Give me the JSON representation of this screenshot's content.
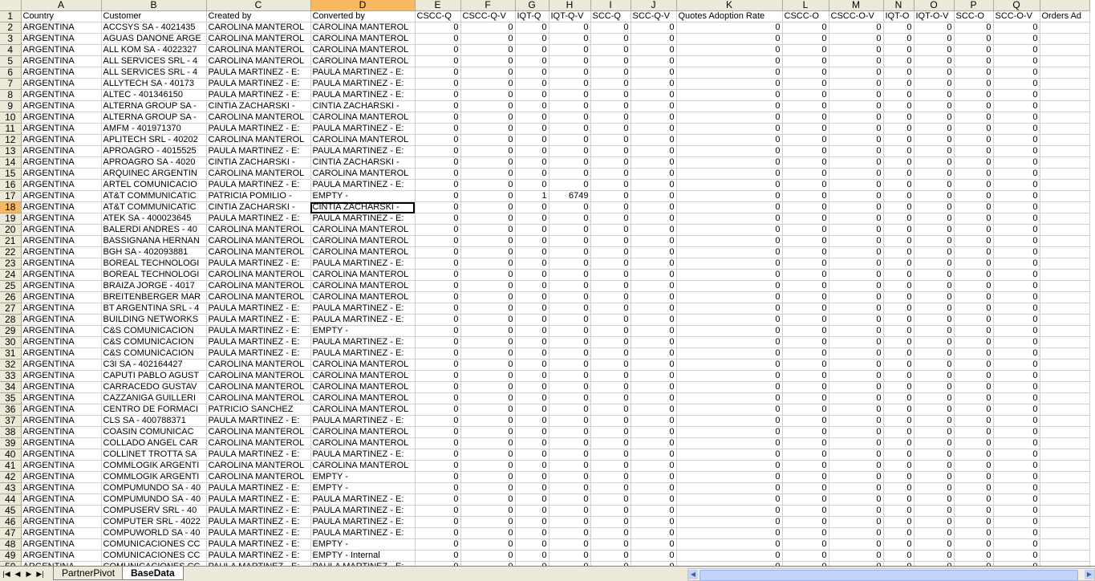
{
  "sheet": {
    "column_letters": [
      "A",
      "B",
      "C",
      "D",
      "E",
      "F",
      "G",
      "H",
      "I",
      "J",
      "K",
      "L",
      "M",
      "N",
      "O",
      "P",
      "Q",
      ""
    ],
    "selected_column": "D",
    "selected_row": 18,
    "headers": [
      "Country",
      "Customer",
      "Created by",
      "Converted by",
      "CSCC-Q",
      "CSCC-Q-V",
      "IQT-Q",
      "IQT-Q-V",
      "SCC-Q",
      "SCC-Q-V",
      "Quotes Adoption Rate",
      "CSCC-O",
      "CSCC-O-V",
      "IQT-O",
      "IQT-O-V",
      "SCC-O",
      "SCC-O-V",
      "Orders Ad"
    ],
    "rows": [
      [
        "ARGENTINA",
        "ACCSYS SA - 4021435",
        "CAROLINA  MANTEROL",
        "CAROLINA  MANTEROL"
      ],
      [
        "ARGENTINA",
        "AGUAS DANONE ARGE",
        "CAROLINA  MANTEROL",
        "CAROLINA  MANTEROL"
      ],
      [
        "ARGENTINA",
        "ALL KOM SA - 4022327",
        "CAROLINA  MANTEROL",
        "CAROLINA  MANTEROL"
      ],
      [
        "ARGENTINA",
        "ALL SERVICES SRL - 4",
        "CAROLINA  MANTEROL",
        "CAROLINA  MANTEROL"
      ],
      [
        "ARGENTINA",
        "ALL SERVICES SRL - 4",
        "PAULA  MARTINEZ - E:",
        "PAULA  MARTINEZ - E:"
      ],
      [
        "ARGENTINA",
        "ALLYTECH SA - 40173",
        "PAULA  MARTINEZ - E:",
        "PAULA  MARTINEZ - E:"
      ],
      [
        "ARGENTINA",
        "ALTEC - 401346150",
        "PAULA  MARTINEZ - E:",
        "PAULA  MARTINEZ - E:"
      ],
      [
        "ARGENTINA",
        "ALTERNA GROUP SA -",
        "CINTIA  ZACHARSKI -",
        "CINTIA  ZACHARSKI -"
      ],
      [
        "ARGENTINA",
        "ALTERNA GROUP SA -",
        "CAROLINA  MANTEROL",
        "CAROLINA  MANTEROL"
      ],
      [
        "ARGENTINA",
        "AMFM - 401971370",
        "PAULA  MARTINEZ - E:",
        "PAULA  MARTINEZ - E:"
      ],
      [
        "ARGENTINA",
        "APLITECH SRL - 40202",
        "CAROLINA  MANTEROL",
        "CAROLINA  MANTEROL"
      ],
      [
        "ARGENTINA",
        "APROAGRO - 4015525",
        "PAULA  MARTINEZ - E:",
        "PAULA  MARTINEZ - E:"
      ],
      [
        "ARGENTINA",
        "APROAGRO SA - 4020",
        "CINTIA  ZACHARSKI -",
        "CINTIA  ZACHARSKI -"
      ],
      [
        "ARGENTINA",
        "ARQUINEC ARGENTIN",
        "CAROLINA  MANTEROL",
        "CAROLINA  MANTEROL"
      ],
      [
        "ARGENTINA",
        "ARTEL COMUNICACIO",
        "PAULA  MARTINEZ - E:",
        "PAULA  MARTINEZ - E:"
      ],
      [
        "ARGENTINA",
        "AT&T COMMUNICATIC",
        "PATRICIA  POMILIO -",
        "EMPTY -"
      ],
      [
        "ARGENTINA",
        "AT&T COMMUNICATIC",
        "CINTIA  ZACHARSKI -",
        "CINTIA  ZACHARSKI -"
      ],
      [
        "ARGENTINA",
        "ATEK SA - 400023645",
        "PAULA  MARTINEZ - E:",
        "PAULA  MARTINEZ - E:"
      ],
      [
        "ARGENTINA",
        "BALERDI ANDRES - 40",
        "CAROLINA  MANTEROL",
        "CAROLINA  MANTEROL"
      ],
      [
        "ARGENTINA",
        "BASSIGNANA HERNAN",
        "CAROLINA  MANTEROL",
        "CAROLINA  MANTEROL"
      ],
      [
        "ARGENTINA",
        "BGH SA - 402093881",
        "CAROLINA  MANTEROL",
        "CAROLINA  MANTEROL"
      ],
      [
        "ARGENTINA",
        "BOREAL TECHNOLOGI",
        "PAULA  MARTINEZ - E:",
        "PAULA  MARTINEZ - E:"
      ],
      [
        "ARGENTINA",
        "BOREAL TECHNOLOGI",
        "CAROLINA  MANTEROL",
        "CAROLINA  MANTEROL"
      ],
      [
        "ARGENTINA",
        "BRAIZA JORGE - 4017",
        "CAROLINA  MANTEROL",
        "CAROLINA  MANTEROL"
      ],
      [
        "ARGENTINA",
        "BREITENBERGER MAR",
        "CAROLINA  MANTEROL",
        "CAROLINA  MANTEROL"
      ],
      [
        "ARGENTINA",
        "BT ARGENTINA SRL - 4",
        "PAULA  MARTINEZ - E:",
        "PAULA  MARTINEZ - E:"
      ],
      [
        "ARGENTINA",
        "BUILDING NETWORKS",
        "PAULA  MARTINEZ - E:",
        "PAULA  MARTINEZ - E:"
      ],
      [
        "ARGENTINA",
        "C&S COMUNICACION",
        "PAULA  MARTINEZ - E:",
        "EMPTY -"
      ],
      [
        "ARGENTINA",
        "C&S COMUNICACION",
        "PAULA  MARTINEZ - E:",
        "PAULA  MARTINEZ - E:"
      ],
      [
        "ARGENTINA",
        "C&S COMUNICACION",
        "PAULA  MARTINEZ - E:",
        "PAULA  MARTINEZ - E:"
      ],
      [
        "ARGENTINA",
        "C3I SA - 402164427",
        "CAROLINA  MANTEROL",
        "CAROLINA  MANTEROL"
      ],
      [
        "ARGENTINA",
        "CAPUTI PABLO AGUST",
        "CAROLINA  MANTEROL",
        "CAROLINA  MANTEROL"
      ],
      [
        "ARGENTINA",
        "CARRACEDO GUSTAV",
        "CAROLINA  MANTEROL",
        "CAROLINA  MANTEROL"
      ],
      [
        "ARGENTINA",
        "CAZZANIGA GUILLERI",
        "CAROLINA  MANTEROL",
        "CAROLINA  MANTEROL"
      ],
      [
        "ARGENTINA",
        "CENTRO DE FORMACI",
        "PATRICIO  SANCHEZ",
        "CAROLINA  MANTEROL"
      ],
      [
        "ARGENTINA",
        "CLS SA - 400788371",
        "PAULA  MARTINEZ - E:",
        "PAULA  MARTINEZ - E:"
      ],
      [
        "ARGENTINA",
        "COASIN COMUNICAC",
        "CAROLINA  MANTEROL",
        "CAROLINA  MANTEROL"
      ],
      [
        "ARGENTINA",
        "COLLADO ANGEL CAR",
        "CAROLINA  MANTEROL",
        "CAROLINA  MANTEROL"
      ],
      [
        "ARGENTINA",
        "COLLINET TROTTA SA",
        "PAULA  MARTINEZ - E:",
        "PAULA  MARTINEZ - E:"
      ],
      [
        "ARGENTINA",
        "COMMLOGIK ARGENTI",
        "CAROLINA  MANTEROL",
        "CAROLINA  MANTEROL"
      ],
      [
        "ARGENTINA",
        "COMMLOGIK ARGENTI",
        "CAROLINA  MANTEROL",
        "EMPTY -"
      ],
      [
        "ARGENTINA",
        "COMPUMUNDO SA - 40",
        "PAULA  MARTINEZ - E:",
        "EMPTY -"
      ],
      [
        "ARGENTINA",
        "COMPUMUNDO SA - 40",
        "PAULA  MARTINEZ - E:",
        "PAULA  MARTINEZ - E:"
      ],
      [
        "ARGENTINA",
        "COMPUSERV SRL - 40",
        "PAULA  MARTINEZ - E:",
        "PAULA  MARTINEZ - E:"
      ],
      [
        "ARGENTINA",
        "COMPUTER SRL - 4022",
        "PAULA  MARTINEZ - E:",
        "PAULA  MARTINEZ - E:"
      ],
      [
        "ARGENTINA",
        "COMPUWORLD SA - 40",
        "PAULA  MARTINEZ - E:",
        "PAULA  MARTINEZ - E:"
      ],
      [
        "ARGENTINA",
        "COMUNICACIONES CC",
        "PAULA  MARTINEZ - E:",
        "EMPTY -"
      ],
      [
        "ARGENTINA",
        "COMUNICACIONES CC",
        "PAULA  MARTINEZ - E:",
        "EMPTY - Internal"
      ],
      [
        "ARGENTINA",
        "COMUNICACIONES CC",
        "PAULA  MARTINEZ - E:",
        "PAULA  MARTINEZ - E:"
      ]
    ],
    "numeric_default": "0",
    "numeric_overrides": [
      {
        "row": 17,
        "col": "G",
        "value": "1"
      },
      {
        "row": 17,
        "col": "H",
        "value": "6749"
      }
    ]
  },
  "sheet_tabs": [
    "PartnerPivot",
    "BaseData"
  ],
  "active_tab": "BaseData",
  "nav_buttons": [
    "first-sheet",
    "prev-sheet",
    "next-sheet",
    "last-sheet"
  ]
}
